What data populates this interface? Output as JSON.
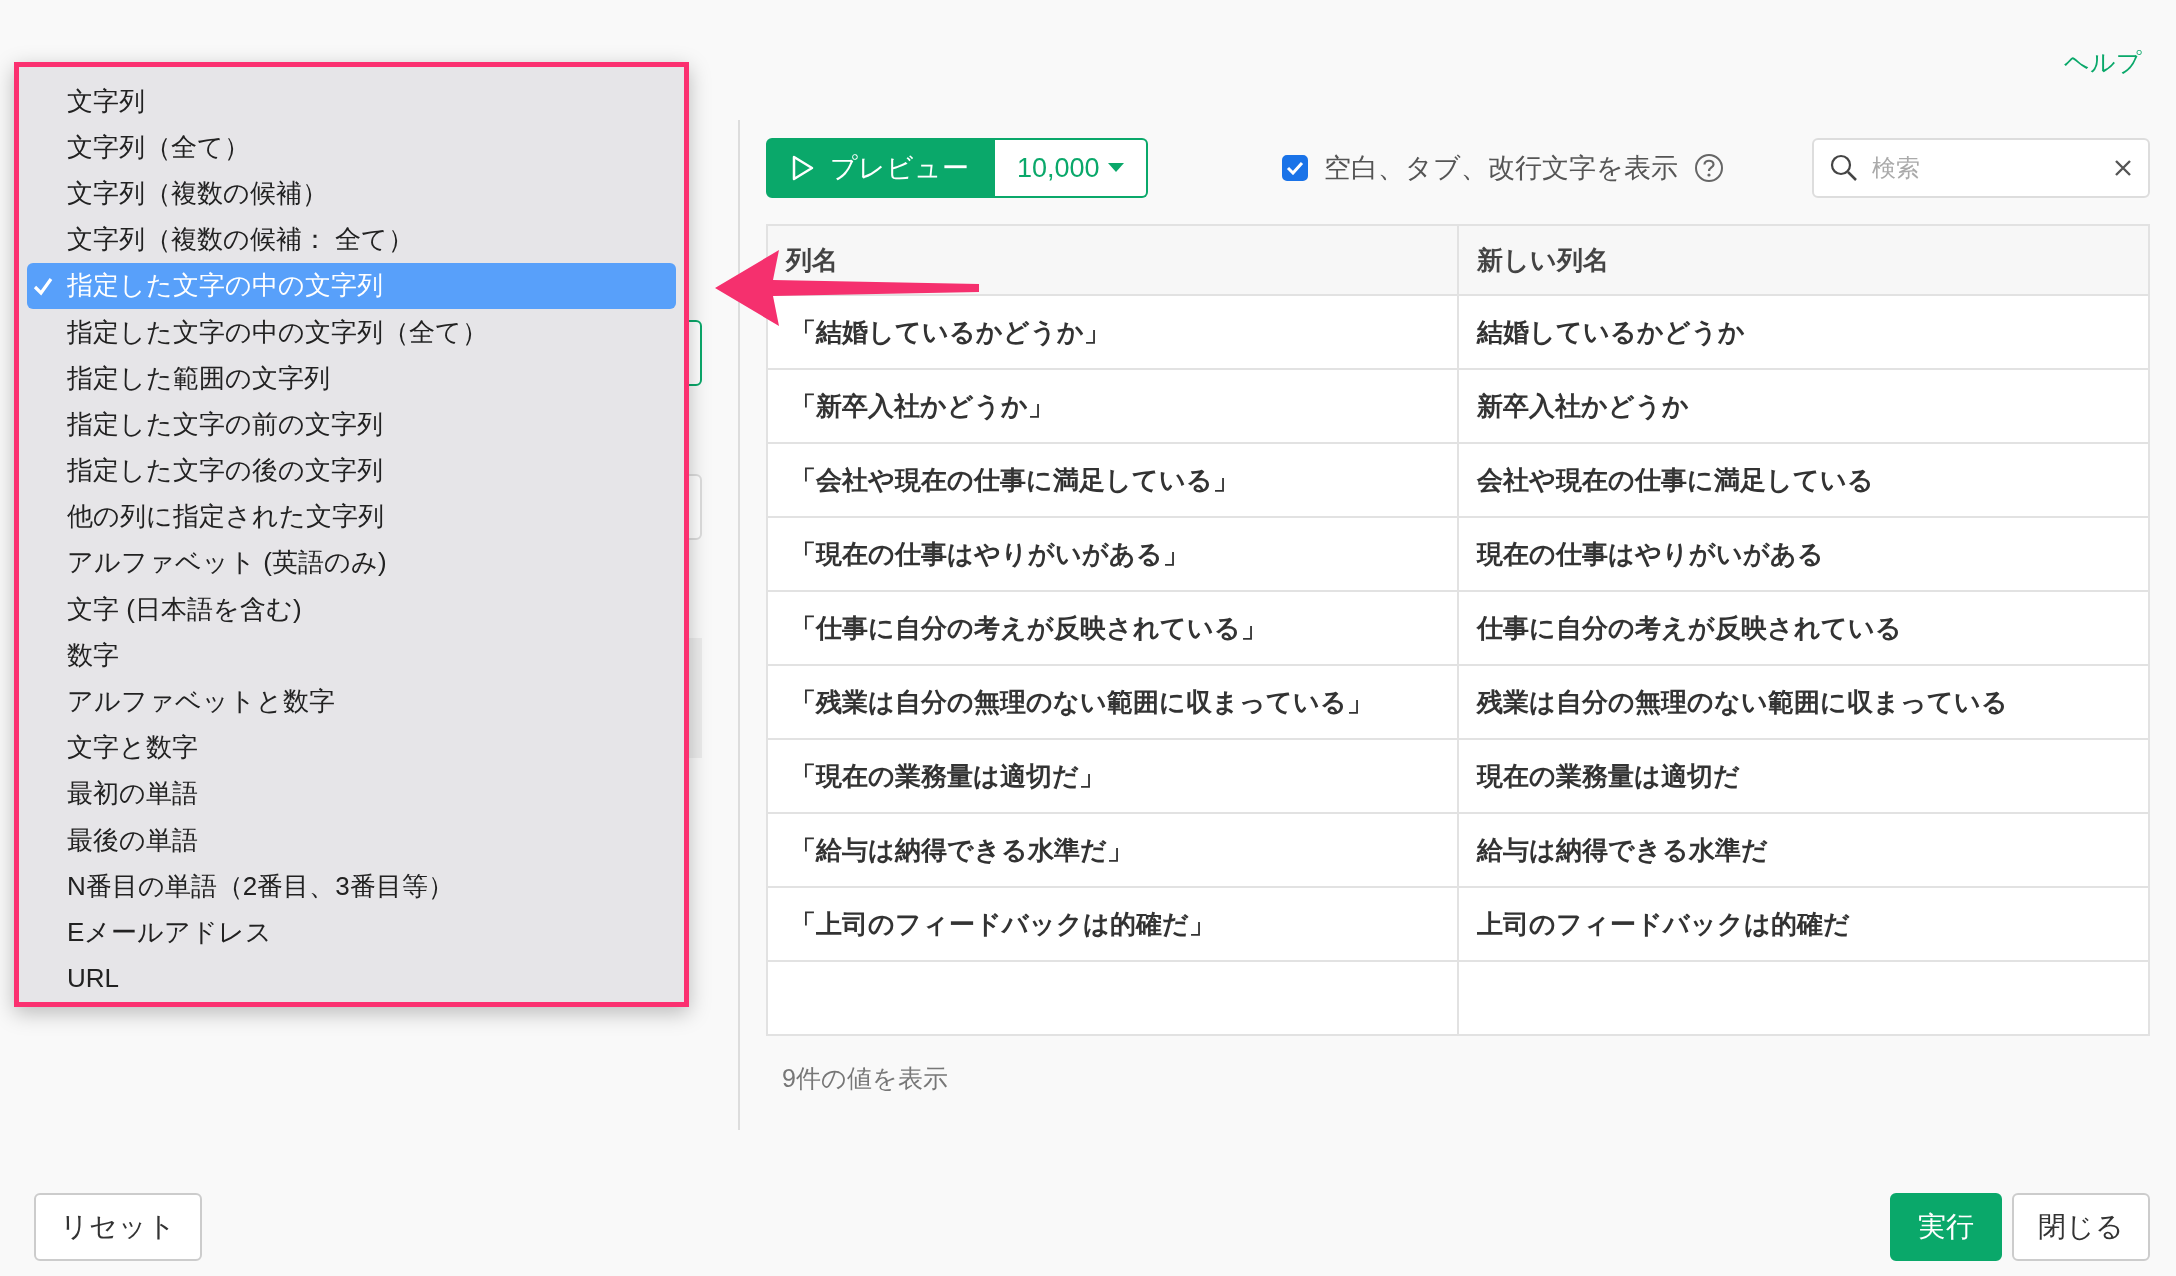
{
  "dialog": {
    "help_link": "ヘルプ"
  },
  "dropdown": {
    "items": [
      {
        "label": "文字列",
        "selected": false
      },
      {
        "label": "文字列（全て）",
        "selected": false
      },
      {
        "label": "文字列（複数の候補）",
        "selected": false
      },
      {
        "label": "文字列（複数の候補： 全て）",
        "selected": false
      },
      {
        "label": "指定した文字の中の文字列",
        "selected": true
      },
      {
        "label": "指定した文字の中の文字列（全て）",
        "selected": false
      },
      {
        "label": "指定した範囲の文字列",
        "selected": false
      },
      {
        "label": "指定した文字の前の文字列",
        "selected": false
      },
      {
        "label": "指定した文字の後の文字列",
        "selected": false
      },
      {
        "label": "他の列に指定された文字列",
        "selected": false
      },
      {
        "label": "アルファベット (英語のみ)",
        "selected": false
      },
      {
        "label": "文字 (日本語を含む)",
        "selected": false
      },
      {
        "label": "数字",
        "selected": false
      },
      {
        "label": "アルファベットと数字",
        "selected": false
      },
      {
        "label": "文字と数字",
        "selected": false
      },
      {
        "label": "最初の単語",
        "selected": false
      },
      {
        "label": "最後の単語",
        "selected": false
      },
      {
        "label": "N番目の単語（2番目、3番目等）",
        "selected": false
      },
      {
        "label": "Eメールアドレス",
        "selected": false
      },
      {
        "label": "URL",
        "selected": false
      }
    ]
  },
  "toolbar": {
    "preview_button": "プレビュー",
    "row_limit": "10,000",
    "show_whitespace": {
      "label": "空白、タブ、改行文字を表示",
      "checked": true
    },
    "search": {
      "placeholder": "検索"
    }
  },
  "table": {
    "columns": [
      "列名",
      "新しい列名"
    ],
    "rows": [
      [
        "「結婚しているかどうか」",
        "結婚しているかどうか"
      ],
      [
        "「新卒入社かどうか」",
        "新卒入社かどうか"
      ],
      [
        "「会社や現在の仕事に満足している」",
        "会社や現在の仕事に満足している"
      ],
      [
        "「現在の仕事はやりがいがある」",
        "現在の仕事はやりがいがある"
      ],
      [
        "「仕事に自分の考えが反映されている」",
        "仕事に自分の考えが反映されている"
      ],
      [
        "「残業は自分の無理のない範囲に収まっている」",
        "残業は自分の無理のない範囲に収まっている"
      ],
      [
        "「現在の業務量は適切だ」",
        "現在の業務量は適切だ"
      ],
      [
        "「給与は納得できる水準だ」",
        "給与は納得できる水準だ"
      ],
      [
        "「上司のフィードバックは的確だ」",
        "上司のフィードバックは的確だ"
      ]
    ]
  },
  "footer_note": "9件の値を表示",
  "buttons": {
    "reset": "リセット",
    "run": "実行",
    "close": "閉じる"
  }
}
